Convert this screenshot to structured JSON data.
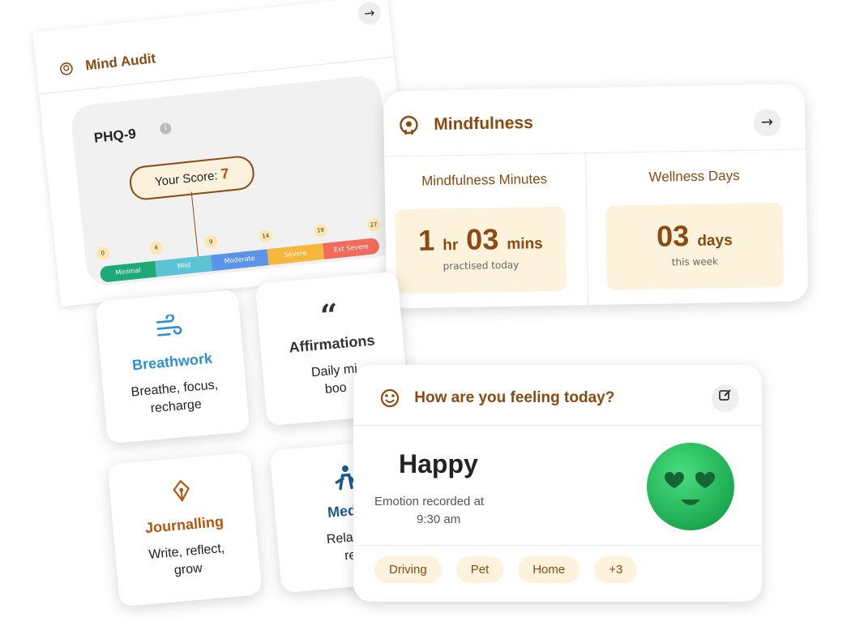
{
  "mind_audit": {
    "title": "Mind Audit",
    "arrow": "→",
    "assessment": "PHQ-9",
    "info": "i",
    "score_label": "Your Score:",
    "score_value": "7",
    "ticks": [
      "0",
      "4",
      "9",
      "14",
      "19",
      "27"
    ],
    "segments": [
      {
        "label": "Minimal",
        "color": "#1fa97a"
      },
      {
        "label": "Mild",
        "color": "#5bc3d6"
      },
      {
        "label": "Moderate",
        "color": "#5b93e8"
      },
      {
        "label": "Severe",
        "color": "#f6b73c"
      },
      {
        "label": "Ext Severe",
        "color": "#ef6b5b"
      }
    ]
  },
  "mindfulness": {
    "title": "Mindfulness",
    "arrow": "→",
    "minutes_label": "Mindfulness Minutes",
    "minutes_hr": "1",
    "minutes_hr_unit": "hr",
    "minutes_min": "03",
    "minutes_min_unit": "mins",
    "minutes_sub": "practised today",
    "days_label": "Wellness Days",
    "days_value": "03",
    "days_unit": "days",
    "days_sub": "this week"
  },
  "tiles": {
    "breathwork": {
      "name": "Breathwork",
      "desc1": "Breathe, focus,",
      "desc2": "recharge",
      "color": "#2f8fd6"
    },
    "affirmations": {
      "name": "Affirmations",
      "desc1": "Daily mi",
      "desc2": "boo",
      "color": "#333333"
    },
    "journalling": {
      "name": "Journalling",
      "desc1": "Write, reflect,",
      "desc2": "grow",
      "color": "#b5550f"
    },
    "meditation": {
      "name": "Medit",
      "desc1": "Relax, r",
      "desc2": "re",
      "color": "#1e5a8c"
    }
  },
  "feeling": {
    "title": "How are you feeling today?",
    "emotion": "Happy",
    "recorded_label": "Emotion recorded at",
    "recorded_time": "9:30 am",
    "tags": [
      "Driving",
      "Pet",
      "Home",
      "+3"
    ]
  },
  "colors": {
    "brand_brown": "#8a4a12",
    "cream": "#fdf2dc",
    "emoji_green": "#22c55e"
  }
}
